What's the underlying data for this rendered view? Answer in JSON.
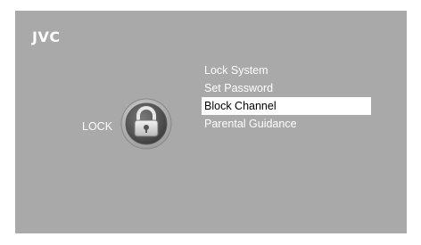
{
  "brand": {
    "logo_text": "JVC"
  },
  "screen": {
    "background": "#a9a9a9",
    "lock_label": "LOCK",
    "lock_icon": "padlock-icon"
  },
  "menu": {
    "items": [
      {
        "label": "Lock System"
      },
      {
        "label": "Set Password"
      },
      {
        "label": "Block Channel",
        "selected": true
      },
      {
        "label": "Parental Guidance"
      }
    ],
    "selected_background": "#ffffff",
    "selected_text_color": "#000000"
  }
}
